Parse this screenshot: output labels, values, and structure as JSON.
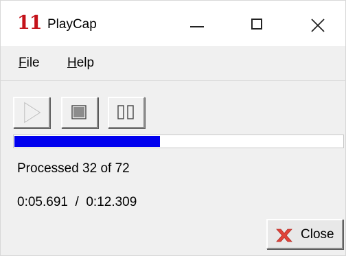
{
  "window": {
    "title": "PlayCap",
    "app_icon_text": "11"
  },
  "title_buttons": {
    "minimize": "minimize-icon",
    "maximize": "maximize-icon",
    "close": "close-icon"
  },
  "menu": {
    "file": {
      "label": "File",
      "accel": "F",
      "rest": "ile"
    },
    "help": {
      "label": "Help",
      "accel": "H",
      "rest": "elp"
    }
  },
  "toolbar": {
    "play": {
      "icon": "play-icon",
      "enabled": false
    },
    "stop": {
      "icon": "stop-icon",
      "enabled": true
    },
    "pause": {
      "icon": "pause-icon",
      "enabled": true
    }
  },
  "progress": {
    "fraction": 0.444,
    "color": "#0000ee"
  },
  "status": {
    "processed": "Processed 32 of 72",
    "time": "0:05.691  /  0:12.309"
  },
  "close_button": {
    "label": "Close",
    "icon": "red-x-icon",
    "icon_color": "#e0433a"
  }
}
